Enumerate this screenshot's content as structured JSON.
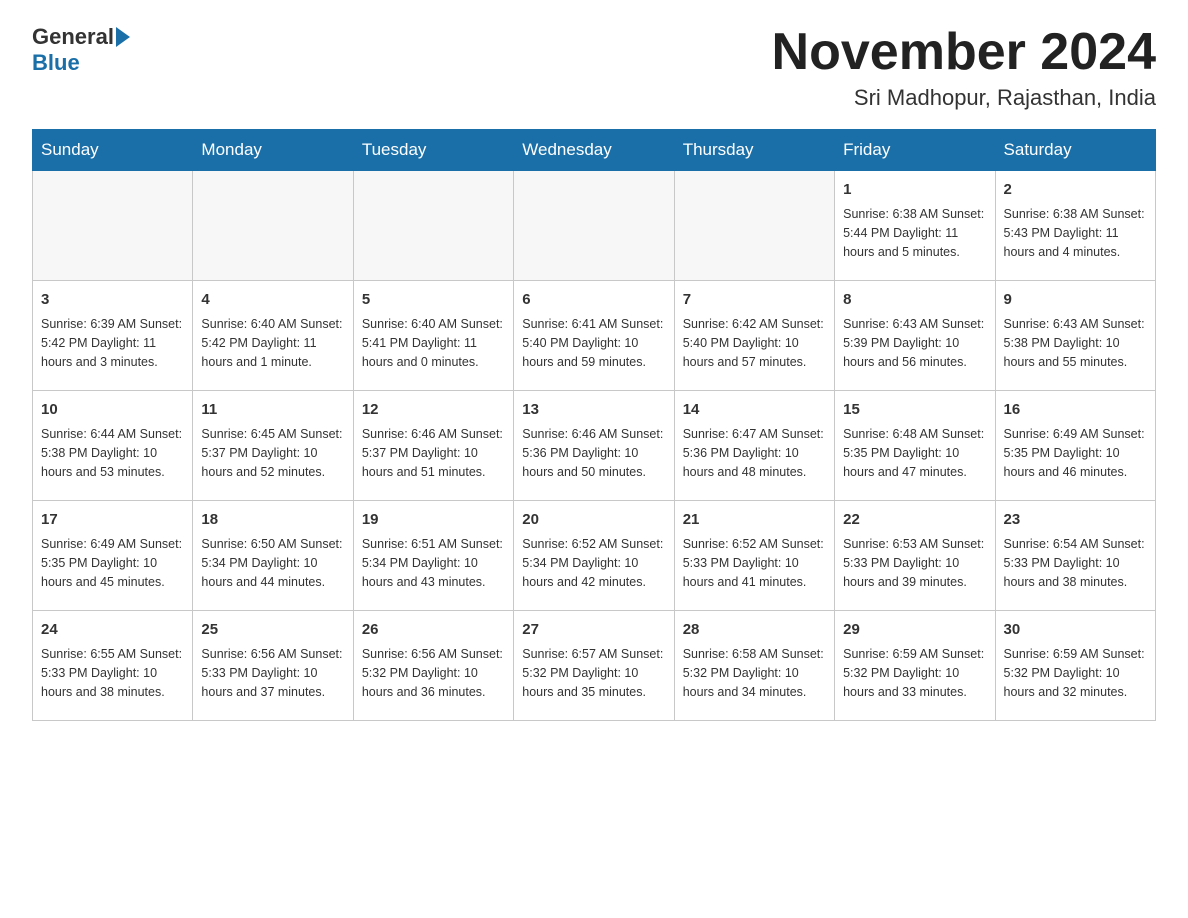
{
  "header": {
    "logo_text": "General",
    "logo_blue": "Blue",
    "month_title": "November 2024",
    "location": "Sri Madhopur, Rajasthan, India"
  },
  "days_of_week": [
    "Sunday",
    "Monday",
    "Tuesday",
    "Wednesday",
    "Thursday",
    "Friday",
    "Saturday"
  ],
  "weeks": [
    [
      {
        "day": "",
        "info": ""
      },
      {
        "day": "",
        "info": ""
      },
      {
        "day": "",
        "info": ""
      },
      {
        "day": "",
        "info": ""
      },
      {
        "day": "",
        "info": ""
      },
      {
        "day": "1",
        "info": "Sunrise: 6:38 AM\nSunset: 5:44 PM\nDaylight: 11 hours and 5 minutes."
      },
      {
        "day": "2",
        "info": "Sunrise: 6:38 AM\nSunset: 5:43 PM\nDaylight: 11 hours and 4 minutes."
      }
    ],
    [
      {
        "day": "3",
        "info": "Sunrise: 6:39 AM\nSunset: 5:42 PM\nDaylight: 11 hours and 3 minutes."
      },
      {
        "day": "4",
        "info": "Sunrise: 6:40 AM\nSunset: 5:42 PM\nDaylight: 11 hours and 1 minute."
      },
      {
        "day": "5",
        "info": "Sunrise: 6:40 AM\nSunset: 5:41 PM\nDaylight: 11 hours and 0 minutes."
      },
      {
        "day": "6",
        "info": "Sunrise: 6:41 AM\nSunset: 5:40 PM\nDaylight: 10 hours and 59 minutes."
      },
      {
        "day": "7",
        "info": "Sunrise: 6:42 AM\nSunset: 5:40 PM\nDaylight: 10 hours and 57 minutes."
      },
      {
        "day": "8",
        "info": "Sunrise: 6:43 AM\nSunset: 5:39 PM\nDaylight: 10 hours and 56 minutes."
      },
      {
        "day": "9",
        "info": "Sunrise: 6:43 AM\nSunset: 5:38 PM\nDaylight: 10 hours and 55 minutes."
      }
    ],
    [
      {
        "day": "10",
        "info": "Sunrise: 6:44 AM\nSunset: 5:38 PM\nDaylight: 10 hours and 53 minutes."
      },
      {
        "day": "11",
        "info": "Sunrise: 6:45 AM\nSunset: 5:37 PM\nDaylight: 10 hours and 52 minutes."
      },
      {
        "day": "12",
        "info": "Sunrise: 6:46 AM\nSunset: 5:37 PM\nDaylight: 10 hours and 51 minutes."
      },
      {
        "day": "13",
        "info": "Sunrise: 6:46 AM\nSunset: 5:36 PM\nDaylight: 10 hours and 50 minutes."
      },
      {
        "day": "14",
        "info": "Sunrise: 6:47 AM\nSunset: 5:36 PM\nDaylight: 10 hours and 48 minutes."
      },
      {
        "day": "15",
        "info": "Sunrise: 6:48 AM\nSunset: 5:35 PM\nDaylight: 10 hours and 47 minutes."
      },
      {
        "day": "16",
        "info": "Sunrise: 6:49 AM\nSunset: 5:35 PM\nDaylight: 10 hours and 46 minutes."
      }
    ],
    [
      {
        "day": "17",
        "info": "Sunrise: 6:49 AM\nSunset: 5:35 PM\nDaylight: 10 hours and 45 minutes."
      },
      {
        "day": "18",
        "info": "Sunrise: 6:50 AM\nSunset: 5:34 PM\nDaylight: 10 hours and 44 minutes."
      },
      {
        "day": "19",
        "info": "Sunrise: 6:51 AM\nSunset: 5:34 PM\nDaylight: 10 hours and 43 minutes."
      },
      {
        "day": "20",
        "info": "Sunrise: 6:52 AM\nSunset: 5:34 PM\nDaylight: 10 hours and 42 minutes."
      },
      {
        "day": "21",
        "info": "Sunrise: 6:52 AM\nSunset: 5:33 PM\nDaylight: 10 hours and 41 minutes."
      },
      {
        "day": "22",
        "info": "Sunrise: 6:53 AM\nSunset: 5:33 PM\nDaylight: 10 hours and 39 minutes."
      },
      {
        "day": "23",
        "info": "Sunrise: 6:54 AM\nSunset: 5:33 PM\nDaylight: 10 hours and 38 minutes."
      }
    ],
    [
      {
        "day": "24",
        "info": "Sunrise: 6:55 AM\nSunset: 5:33 PM\nDaylight: 10 hours and 38 minutes."
      },
      {
        "day": "25",
        "info": "Sunrise: 6:56 AM\nSunset: 5:33 PM\nDaylight: 10 hours and 37 minutes."
      },
      {
        "day": "26",
        "info": "Sunrise: 6:56 AM\nSunset: 5:32 PM\nDaylight: 10 hours and 36 minutes."
      },
      {
        "day": "27",
        "info": "Sunrise: 6:57 AM\nSunset: 5:32 PM\nDaylight: 10 hours and 35 minutes."
      },
      {
        "day": "28",
        "info": "Sunrise: 6:58 AM\nSunset: 5:32 PM\nDaylight: 10 hours and 34 minutes."
      },
      {
        "day": "29",
        "info": "Sunrise: 6:59 AM\nSunset: 5:32 PM\nDaylight: 10 hours and 33 minutes."
      },
      {
        "day": "30",
        "info": "Sunrise: 6:59 AM\nSunset: 5:32 PM\nDaylight: 10 hours and 32 minutes."
      }
    ]
  ]
}
